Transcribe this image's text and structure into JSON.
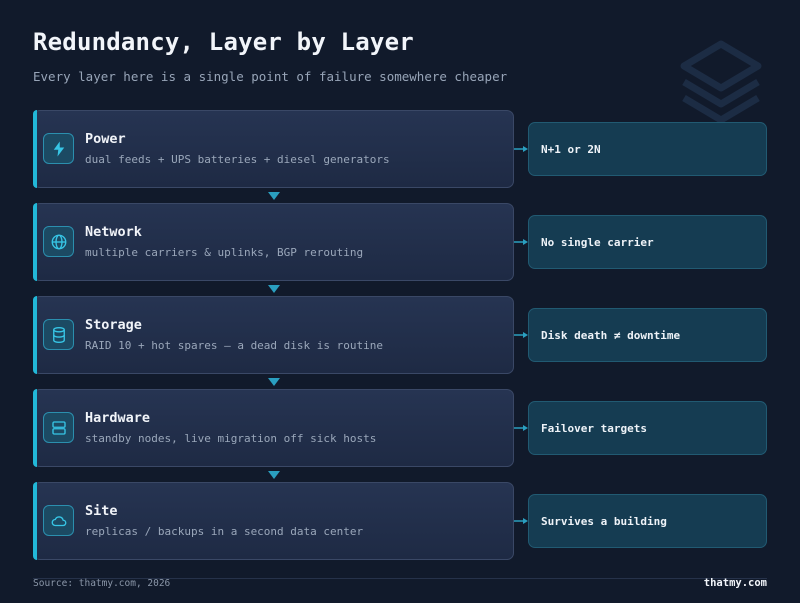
{
  "header": {
    "title": "Redundancy, Layer by Layer",
    "subtitle": "Every layer here is a single point of failure somewhere cheaper"
  },
  "layers": [
    {
      "name": "Power",
      "description": "dual feeds + UPS batteries + diesel generators",
      "icon": "lightning-icon",
      "outcome": "N+1 or 2N"
    },
    {
      "name": "Network",
      "description": "multiple carriers & uplinks, BGP rerouting",
      "icon": "globe-icon",
      "outcome": "No single carrier"
    },
    {
      "name": "Storage",
      "description": "RAID 10 + hot spares — a dead disk is routine",
      "icon": "database-icon",
      "outcome": "Disk death ≠ downtime"
    },
    {
      "name": "Hardware",
      "description": "standby nodes, live migration off sick hosts",
      "icon": "server-icon",
      "outcome": "Failover targets"
    },
    {
      "name": "Site",
      "description": "replicas / backups in a second data center",
      "icon": "cloud-icon",
      "outcome": "Survives a building"
    }
  ],
  "footer": {
    "source": "Source: thatmy.com, 2026",
    "brand": "thatmy.com"
  },
  "colors": {
    "background": "#111a2b",
    "accent": "#22b8d8",
    "card": "#243150",
    "outcome_card": "#153c52"
  }
}
